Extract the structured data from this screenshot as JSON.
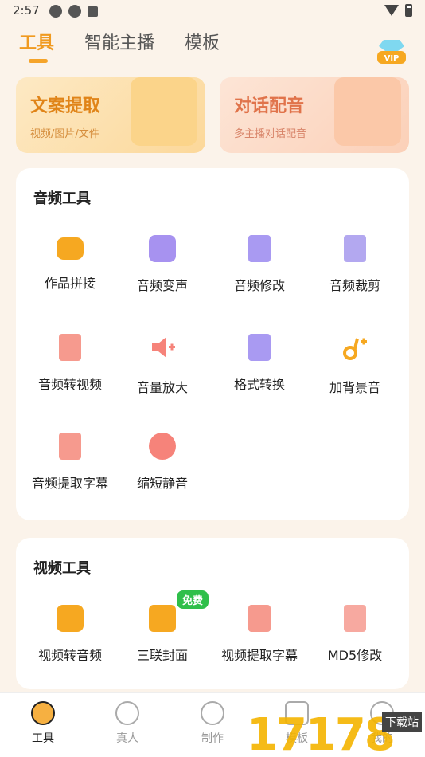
{
  "status": {
    "time": "2:57"
  },
  "tabs": [
    "工具",
    "智能主播",
    "模板"
  ],
  "vip": "VIP",
  "features": [
    {
      "title": "文案提取",
      "subtitle": "视频/图片/文件"
    },
    {
      "title": "对话配音",
      "subtitle": "多主播对话配音"
    }
  ],
  "audio": {
    "title": "音频工具",
    "items": [
      "作品拼接",
      "音频变声",
      "音频修改",
      "音频裁剪",
      "音频转视频",
      "音量放大",
      "格式转换",
      "加背景音",
      "音频提取字幕",
      "缩短静音"
    ]
  },
  "video": {
    "title": "视频工具",
    "items": [
      "视频转音频",
      "三联封面",
      "视频提取字幕",
      "MD5修改"
    ],
    "free_badge": "免费"
  },
  "nav": [
    "工具",
    "真人",
    "制作",
    "模板",
    "我的"
  ],
  "watermark": {
    "number": "17178",
    "site": "下载站"
  }
}
